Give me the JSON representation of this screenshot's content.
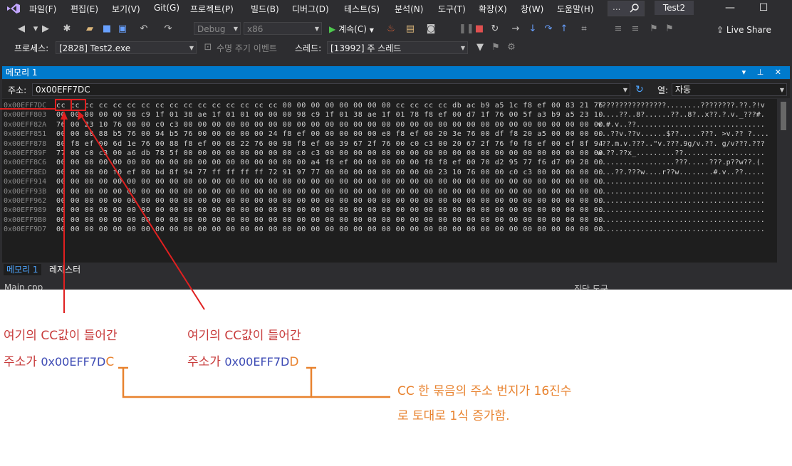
{
  "menubar": {
    "items": [
      "파일(F)",
      "편집(E)",
      "보기(V)",
      "Git(G)",
      "프로젝트(P)",
      "빌드(B)",
      "디버그(D)",
      "테스트(S)",
      "분석(N)",
      "도구(T)",
      "확장(X)",
      "창(W)",
      "도움말(H)"
    ],
    "search_text": "...",
    "solution_title": "Test2"
  },
  "toolbar": {
    "config": "Debug",
    "platform": "x86",
    "continue_label": "계속(C)",
    "live_share_label": "Live Share"
  },
  "debug_location": {
    "process_label": "프로세스:",
    "process_value": "[2828] Test2.exe",
    "lifecycle_label": "수명 주기 이벤트",
    "thread_label": "스레드:",
    "thread_value": "[13992] 주 스레드"
  },
  "memory_window": {
    "title": "메모리 1",
    "address_label": "주소:",
    "address_value": "0x00EFF7DC",
    "columns_label": "열:",
    "columns_value": "자동",
    "rows": [
      {
        "addr": "0x00EFF7DC",
        "bytes": "cc cc cc cc cc cc cc cc cc cc cc cc cc cc cc cc 00 00 00 00 00 00 00 00 cc cc cc cc db ac b9 a5 1c f8 ef 00 83 21 76",
        "ascii": "????????????????........????????.??.?!v"
      },
      {
        "addr": "0x00EFF803",
        "bytes": "00 00 00 00 00 98 c9 1f 01 38 ae 1f 01 01 00 00 00 98 c9 1f 01 38 ae 1f 01 78 f8 ef 00 d7 1f 76 00 5f a3 b9 a5 23 10",
        "ascii": ".....??..8?......??..8?..x??.?.v._???#."
      },
      {
        "addr": "0x00EFF82A",
        "bytes": "76 00 23 10 76 00 00 c0 c3 00 00 00 00 00 00 00 00 00 00 00 00 00 00 00 00 00 00 00 00 00 00 00 00 00 00 00 00 00 00",
        "ascii": "v.#.v..??.............................."
      },
      {
        "addr": "0x00EFF851",
        "bytes": "00 00 00 88 b5 76 00 94 b5 76 00 00 00 00 00 24 f8 ef 00 00 00 00 00 e0 f8 ef 00 20 3e 76 00 df f8 20 a5 00 00 00 00",
        "ascii": "...??v.??v......$??.....???. >v.?? ?...."
      },
      {
        "addr": "0x00EFF878",
        "bytes": "80 f8 ef 00 6d 1e 76 00 88 f8 ef 00 08 22 76 00 98 f8 ef 00 39 67 2f 76 00 c0 c3 00 20 67 2f 76 f0 f8 ef 00 ef 8f 94",
        "ascii": ".??.m.v.???..\"v.???.9g/v.??. g/v???.???"
      },
      {
        "addr": "0x00EFF89F",
        "bytes": "77 00 c0 c3 00 a6 db 78 5f 00 00 00 00 00 00 00 00 c0 c3 00 00 00 00 00 00 00 00 00 00 00 00 00 00 00 00 00 00 00 00",
        "ascii": "w.??.??x_.........??..................."
      },
      {
        "addr": "0x00EFF8C6",
        "bytes": "00 00 00 00 00 00 00 00 00 00 00 00 00 00 00 00 00 00 a4 f8 ef 00 00 00 00 00 f8 f8 ef 00 70 d2 95 77 f6 d7 09 28 00",
        "ascii": "..................???.....???.p??w??.(."
      },
      {
        "addr": "0x00EFF8ED",
        "bytes": "00 00 00 00 f0 ef 00 bd 8f 94 77 ff ff ff ff 72 91 97 77 00 00 00 00 00 00 00 00 23 10 76 00 00 c0 c3 00 00 00 00 00",
        "ascii": "....??.???w....r??w........#.v..??....."
      },
      {
        "addr": "0x00EFF914",
        "bytes": "00 00 00 00 00 00 00 00 00 00 00 00 00 00 00 00 00 00 00 00 00 00 00 00 00 00 00 00 00 00 00 00 00 00 00 00 00 00 00",
        "ascii": "......................................."
      },
      {
        "addr": "0x00EFF93B",
        "bytes": "00 00 00 00 00 00 00 00 00 00 00 00 00 00 00 00 00 00 00 00 00 00 00 00 00 00 00 00 00 00 00 00 00 00 00 00 00 00 00",
        "ascii": "......................................."
      },
      {
        "addr": "0x00EFF962",
        "bytes": "00 00 00 00 00 00 00 00 00 00 00 00 00 00 00 00 00 00 00 00 00 00 00 00 00 00 00 00 00 00 00 00 00 00 00 00 00 00 00",
        "ascii": "......................................."
      },
      {
        "addr": "0x00EFF989",
        "bytes": "00 00 00 00 00 00 00 00 00 00 00 00 00 00 00 00 00 00 00 00 00 00 00 00 00 00 00 00 00 00 00 00 00 00 00 00 00 00 00",
        "ascii": "......................................."
      },
      {
        "addr": "0x00EFF9B0",
        "bytes": "00 00 00 00 00 00 00 00 00 00 00 00 00 00 00 00 00 00 00 00 00 00 00 00 00 00 00 00 00 00 00 00 00 00 00 00 00 00 00",
        "ascii": "......................................."
      },
      {
        "addr": "0x00EFF9D7",
        "bytes": "00 00 00 00 00 00 00 00 00 00 00 00 00 00 00 00 00 00 00 00 00 00 00 00 00 00 00 00 00 00 00 00 00 00 00 00 00 00 00",
        "ascii": "......................................."
      }
    ],
    "bottom_tabs": [
      "메모리 1",
      "레지스터"
    ]
  },
  "document_tabs": {
    "left": "Main.cpp",
    "right": "진단 도구"
  },
  "annotations": {
    "left_line1": "여기의 CC값이 들어간",
    "left_line2_prefix": "주소가 ",
    "left_addr": "0x00EFF7D",
    "left_suffix": "C",
    "right_line1": "여기의 CC값이 들어간",
    "right_line2_prefix": "주소가 ",
    "right_addr": "0x00EFF7D",
    "right_suffix": "D",
    "note_line1": "CC 한 묶음의 주소 번지가 16진수",
    "note_line2": "로 토대로 1식 증가함.",
    "colors": {
      "red": "#c83c3c",
      "blue": "#3c4ab4",
      "orange": "#e8822e"
    }
  }
}
